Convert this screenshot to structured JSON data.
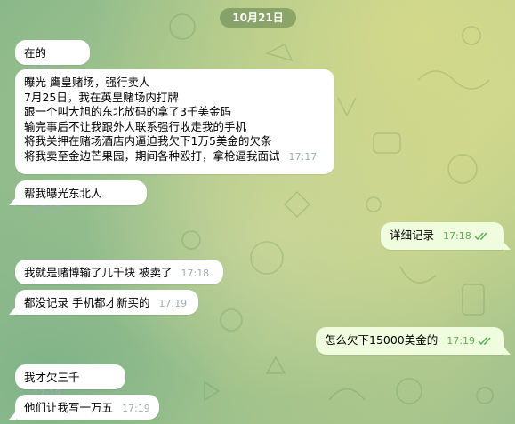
{
  "chat": {
    "date_label": "10月21日",
    "messages": [
      {
        "direction": "in",
        "text": "在的",
        "time": "17:17"
      },
      {
        "direction": "in",
        "text": "曝光 鹰皇赌场，强行卖人\n7月25日，我在英皇赌场内打牌\n跟一个叫大旭的东北放码的拿了3千美金码\n输完事后不让我跟外人联系强行收走我的手机\n将我关押在赌场酒店内逼迫我欠下1万5美金的欠条\n将我卖至金边芒果园，期间各种殴打，拿枪逼我面试",
        "time": "17:17"
      },
      {
        "direction": "in",
        "text": "帮我曝光东北人",
        "time": "17:17"
      },
      {
        "direction": "out",
        "text": "详细记录",
        "time": "17:18",
        "status": "read"
      },
      {
        "direction": "in",
        "text": "我就是赌博输了几千块 被卖了",
        "time": "17:18"
      },
      {
        "direction": "in",
        "text": "都没记录 手机都才新买的",
        "time": "17:19"
      },
      {
        "direction": "out",
        "text": "怎么欠下15000美金的",
        "time": "17:19",
        "status": "read"
      },
      {
        "direction": "in",
        "text": "我才欠三千",
        "time": "17:19"
      },
      {
        "direction": "in",
        "text": "他们让我写一万五",
        "time": "17:19"
      }
    ]
  },
  "colors": {
    "incoming_bubble": "#ffffff",
    "outgoing_bubble": "#effdde",
    "read_ticks": "#5fae57",
    "timestamp": "#a0acb6",
    "date_pill": "#6e8c55"
  },
  "icons": {
    "read_status": "double-check-icon"
  }
}
